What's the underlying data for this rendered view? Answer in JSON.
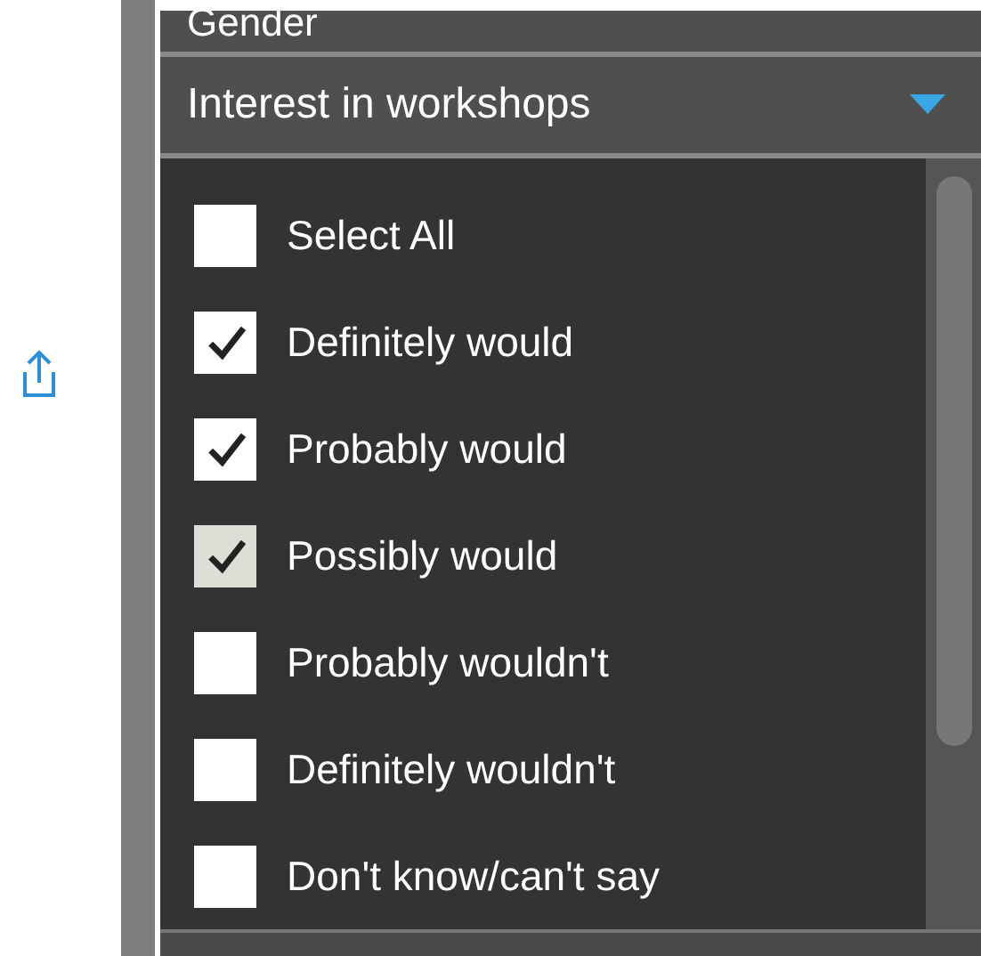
{
  "sections": [
    {
      "title": "Gender",
      "expanded": false
    },
    {
      "title": "Interest in workshops",
      "expanded": true
    }
  ],
  "options": [
    {
      "label": "Select All",
      "checked": false,
      "disabled": false
    },
    {
      "label": "Definitely would",
      "checked": true,
      "disabled": false
    },
    {
      "label": "Probably would",
      "checked": true,
      "disabled": false
    },
    {
      "label": "Possibly would",
      "checked": true,
      "disabled": true
    },
    {
      "label": "Probably wouldn't",
      "checked": false,
      "disabled": false
    },
    {
      "label": "Definitely wouldn't",
      "checked": false,
      "disabled": false
    },
    {
      "label": "Don't know/can't say",
      "checked": false,
      "disabled": false
    }
  ]
}
